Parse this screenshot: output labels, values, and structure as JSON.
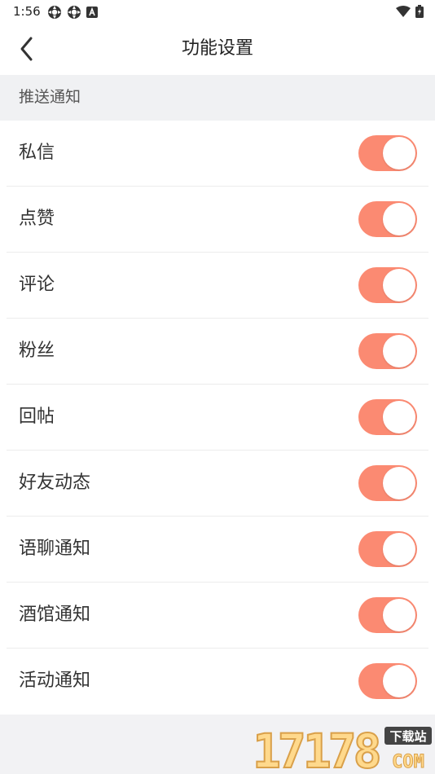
{
  "status_bar": {
    "time": "1:56",
    "left_icons": [
      "settings-gear-icon",
      "settings-gear-icon",
      "notification-a-icon"
    ],
    "right_icons": [
      "wifi-icon",
      "battery-icon"
    ]
  },
  "header": {
    "title": "功能设置",
    "back_icon": "chevron-left-icon"
  },
  "section": {
    "title": "推送通知"
  },
  "settings": {
    "items": [
      {
        "label": "私信",
        "enabled": true
      },
      {
        "label": "点赞",
        "enabled": true
      },
      {
        "label": "评论",
        "enabled": true
      },
      {
        "label": "粉丝",
        "enabled": true
      },
      {
        "label": "回帖",
        "enabled": true
      },
      {
        "label": "好友动态",
        "enabled": true
      },
      {
        "label": "语聊通知",
        "enabled": true
      },
      {
        "label": "酒馆通知",
        "enabled": true
      },
      {
        "label": "活动通知",
        "enabled": true
      }
    ]
  },
  "watermark": {
    "number": "17178",
    "badge": "下载站",
    "suffix": "COM"
  },
  "colors": {
    "toggle_on": "#fb8a72",
    "section_bg": "#f0f1f3",
    "page_bg": "#f2f2f4"
  }
}
